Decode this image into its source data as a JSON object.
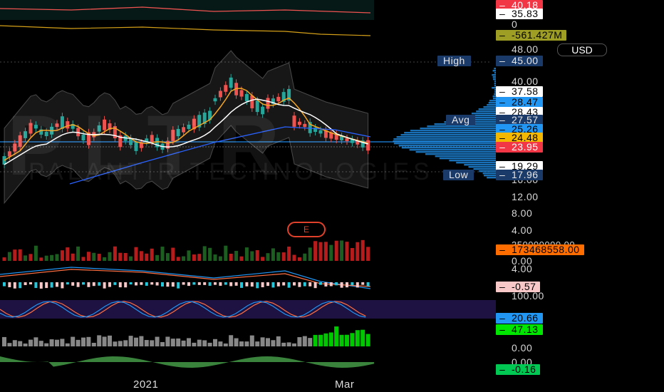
{
  "currency_button": "USD",
  "watermark_symbol": "PLTR",
  "watermark_name": "PALANTIR TECHNOLOGIES",
  "earnings_marker": "E",
  "x_axis_labels": [
    "2021",
    "Mar"
  ],
  "price_axis_ticks": [
    "48.00",
    "40.00",
    "16.00",
    "12.00",
    "8.00",
    "4.00"
  ],
  "tags": {
    "rsi_top": "40.18",
    "rsi_mid": "35.83",
    "zero": "0",
    "obv": "-561.427M",
    "high": "45.00",
    "r1": "37.58",
    "r2": "28.47",
    "r3": "28.43",
    "avg": "27.57",
    "r4": "25.26",
    "r5": "24.48",
    "last": "23.95",
    "s1": "19.29",
    "low": "17.96",
    "volume_scale": "350000000.00",
    "volume": "173468558.00",
    "vol_zero": "0.00",
    "macd_top": "4.00",
    "macd": "-0.57",
    "stoch_top": "100.00",
    "stoch_k": "20.66",
    "stoch_d": "47.13",
    "hist_zero": "0.00",
    "ao_zero": "0.00",
    "ao": "-0.16"
  },
  "tag_labels": {
    "high": "High",
    "avg": "Avg",
    "low": "Low"
  },
  "colors": {
    "up": "#26a69a",
    "down": "#ef5350",
    "ema_fast": "#f5a623",
    "ema_slow": "#ffffff",
    "sma": "#2962ff",
    "volume_up": "#1b5e20",
    "volume_down": "#b71c1c",
    "stoch_band": "#2a1a5e",
    "histo_green": "#00c800",
    "ao_green": "#4caf50"
  }
}
